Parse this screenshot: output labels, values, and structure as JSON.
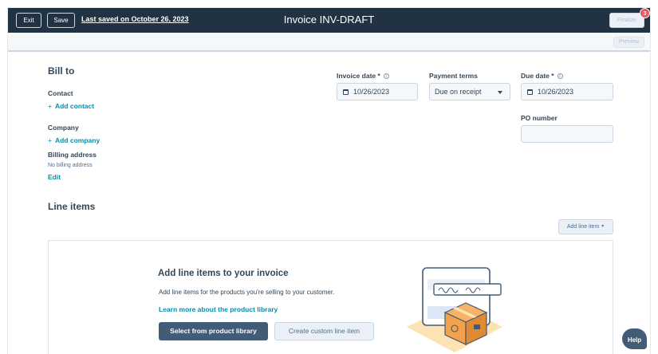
{
  "topbar": {
    "exit_label": "Exit",
    "save_label": "Save",
    "last_saved": "Last saved on October 26, 2023",
    "title": "Invoice INV-DRAFT",
    "finalize_label": "Finalize",
    "notification_count": "3"
  },
  "subbar": {
    "preview_label": "Preview"
  },
  "bill_to": {
    "heading": "Bill to",
    "contact_label": "Contact",
    "add_contact": "Add contact",
    "company_label": "Company",
    "add_company": "Add company",
    "billing_address_label": "Billing address",
    "billing_address_value": "No billing address",
    "edit_label": "Edit"
  },
  "fields": {
    "invoice_date_label": "Invoice date *",
    "invoice_date_value": "10/26/2023",
    "payment_terms_label": "Payment terms",
    "payment_terms_value": "Due on receipt",
    "due_date_label": "Due date *",
    "due_date_value": "10/26/2023",
    "po_number_label": "PO number",
    "po_number_value": ""
  },
  "line_items": {
    "heading": "Line items",
    "add_line_item": "Add line item",
    "empty_title": "Add line items to your invoice",
    "empty_desc": "Add line items for the products you're selling to your customer.",
    "learn_more": "Learn more about the product library",
    "select_from_library": "Select from product library",
    "create_custom": "Create custom line item"
  },
  "help_label": "Help",
  "icons": {
    "info": "info-icon",
    "calendar": "calendar-icon",
    "caret": "chevron-down-icon",
    "plus": "plus-icon",
    "illustration": "product-box-illustration"
  },
  "colors": {
    "topbar_bg": "#213343",
    "link": "#0091ae",
    "primary_button": "#425b76",
    "badge": "#f2545b"
  }
}
